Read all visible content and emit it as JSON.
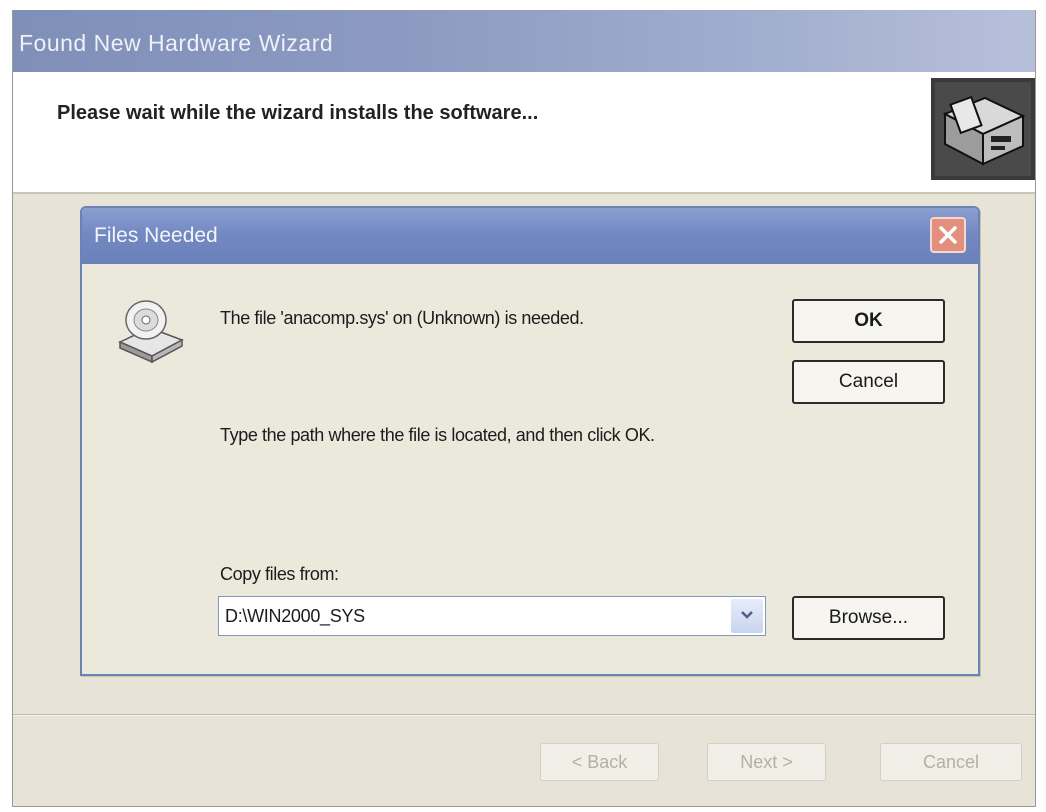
{
  "wizard": {
    "title": "Found New Hardware Wizard",
    "header_text": "Please wait while the wizard installs the software...",
    "header_icon": "hardware-install-icon",
    "buttons": {
      "back": "< Back",
      "next": "Next >",
      "cancel": "Cancel"
    }
  },
  "dialog": {
    "title": "Files Needed",
    "close_icon": "close-icon",
    "icon": "cd-drive-icon",
    "message": "The file 'anacomp.sys' on (Unknown) is needed.",
    "instruction": "Type the path where the file is located, and then click OK.",
    "copy_label": "Copy files from:",
    "path_value": "D:\\WIN2000_SYS",
    "buttons": {
      "ok": "OK",
      "cancel": "Cancel",
      "browse": "Browse..."
    }
  },
  "colors": {
    "close_button": "#e38f7e",
    "dialog_titlebar": "#7389c2",
    "window_background": "#e7e3d6"
  }
}
